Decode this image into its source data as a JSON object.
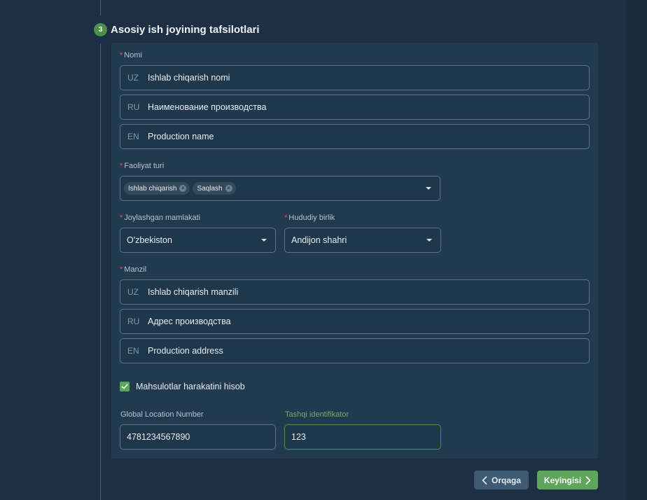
{
  "step": {
    "number": "3",
    "title": "Asosiy ish joyining tafsilotlari"
  },
  "name": {
    "label": "Nomi",
    "fields": [
      {
        "lang": "UZ",
        "value": "Ishlab chiqarish nomi"
      },
      {
        "lang": "RU",
        "value": "Наименование производства"
      },
      {
        "lang": "EN",
        "value": "Production name"
      }
    ]
  },
  "activity": {
    "label": "Faoliyat turi",
    "tags": [
      "Ishlab chiqarish",
      "Saqlash"
    ]
  },
  "country": {
    "label": "Joylashgan mamlakati",
    "value": "O'zbekiston"
  },
  "region": {
    "label": "Hududiy birlik",
    "value": "Andijon shahri"
  },
  "address": {
    "label": "Manzil",
    "fields": [
      {
        "lang": "UZ",
        "value": "Ishlab chiqarish manzili"
      },
      {
        "lang": "RU",
        "value": "Адрес производства"
      },
      {
        "lang": "EN",
        "value": "Production address"
      }
    ]
  },
  "tracking": {
    "label": "Mahsulotlar harakatini hisob",
    "checked": true
  },
  "gln": {
    "label": "Global Location Number",
    "value": "4781234567890"
  },
  "external_id": {
    "label": "Tashqi identifikator",
    "value": "123"
  },
  "buttons": {
    "back": "Orqaga",
    "next": "Keyingisi"
  },
  "colors": {
    "accent": "#5fa65c",
    "required": "#e2525c",
    "background": "#1d3043"
  }
}
